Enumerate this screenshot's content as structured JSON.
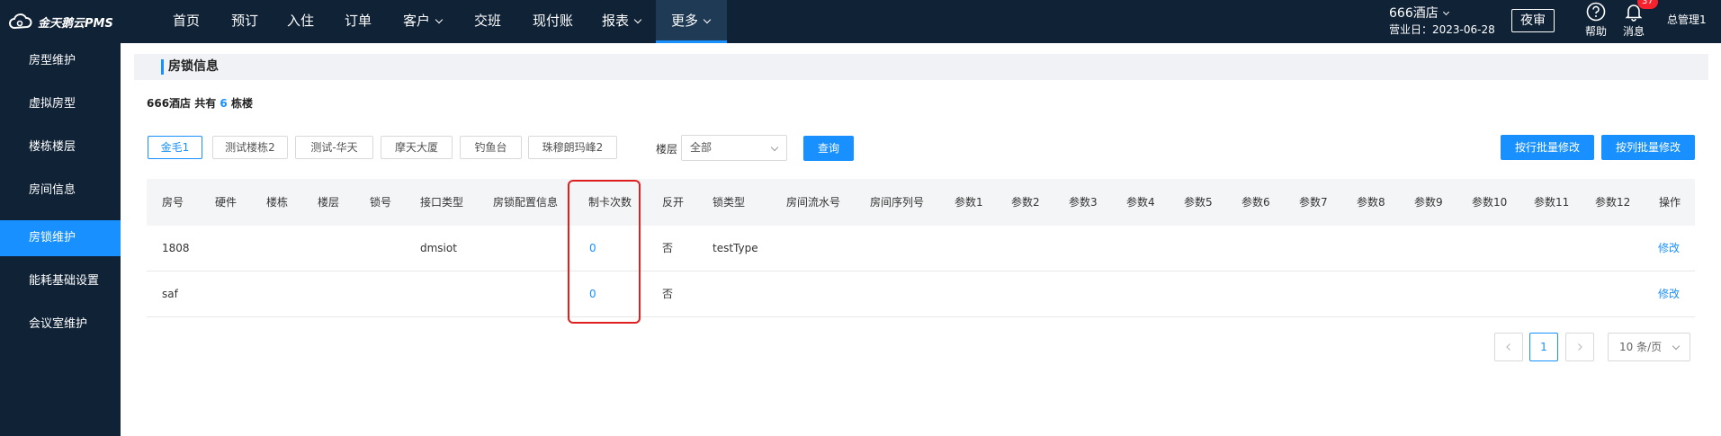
{
  "app": {
    "logo_text": "金天鹅云PMS"
  },
  "nav": {
    "items": [
      {
        "label": "首页"
      },
      {
        "label": "预订"
      },
      {
        "label": "入住"
      },
      {
        "label": "订单"
      },
      {
        "label": "客户"
      },
      {
        "label": "交班"
      },
      {
        "label": "现付账"
      },
      {
        "label": "报表"
      },
      {
        "label": "更多"
      }
    ],
    "active": "更多"
  },
  "header": {
    "hotel": "666酒店",
    "business_date": "营业日：2023-06-28",
    "night_audit": "夜审",
    "help": "帮助",
    "messages": "消息",
    "message_count": "37",
    "user": "总管理1"
  },
  "sidebar": {
    "items": [
      {
        "label": "房型维护"
      },
      {
        "label": "虚拟房型"
      },
      {
        "label": "楼栋楼层"
      },
      {
        "label": "房间信息"
      },
      {
        "label": "房锁维护"
      },
      {
        "label": "能耗基础设置"
      },
      {
        "label": "会议室维护"
      }
    ],
    "active": "房锁维护"
  },
  "section": {
    "title": "房锁信息"
  },
  "summary": {
    "hotel": "666酒店",
    "mid": " 共有 ",
    "count": "6",
    "suffix": " 栋楼"
  },
  "buildings": [
    {
      "label": "金毛1"
    },
    {
      "label": "测试楼栋2"
    },
    {
      "label": "测试-华天"
    },
    {
      "label": "摩天大厦"
    },
    {
      "label": "钓鱼台"
    },
    {
      "label": "珠穆朗玛峰2"
    }
  ],
  "filter": {
    "floor_label": "楼层",
    "floor_value": "全部",
    "query_label": "查询"
  },
  "actions": {
    "batch_row": "按行批量修改",
    "batch_col": "按列批量修改"
  },
  "table": {
    "columns": [
      "房号",
      "硬件",
      "楼栋",
      "楼层",
      "锁号",
      "接口类型",
      "房锁配置信息",
      "制卡次数",
      "反开",
      "锁类型",
      "房间流水号",
      "房间序列号",
      "参数1",
      "参数2",
      "参数3",
      "参数4",
      "参数5",
      "参数6",
      "参数7",
      "参数8",
      "参数9",
      "参数10",
      "参数11",
      "参数12",
      "操作"
    ],
    "rows": [
      {
        "room": "1808",
        "hardware": "",
        "building": "",
        "floor": "",
        "lock_no": "",
        "interface": "dmsiot",
        "config": "",
        "card_count": "0",
        "reverse": "否",
        "lock_type": "testType",
        "action": "修改"
      },
      {
        "room": "saf",
        "hardware": "",
        "building": "",
        "floor": "",
        "lock_no": "",
        "interface": "",
        "config": "",
        "card_count": "0",
        "reverse": "否",
        "lock_type": "",
        "action": "修改"
      }
    ]
  },
  "pagination": {
    "current": "1",
    "page_size": "10 条/页"
  },
  "colors": {
    "accent": "#1890ff",
    "nav_bg": "#0f2236",
    "highlight": "#e02020"
  }
}
